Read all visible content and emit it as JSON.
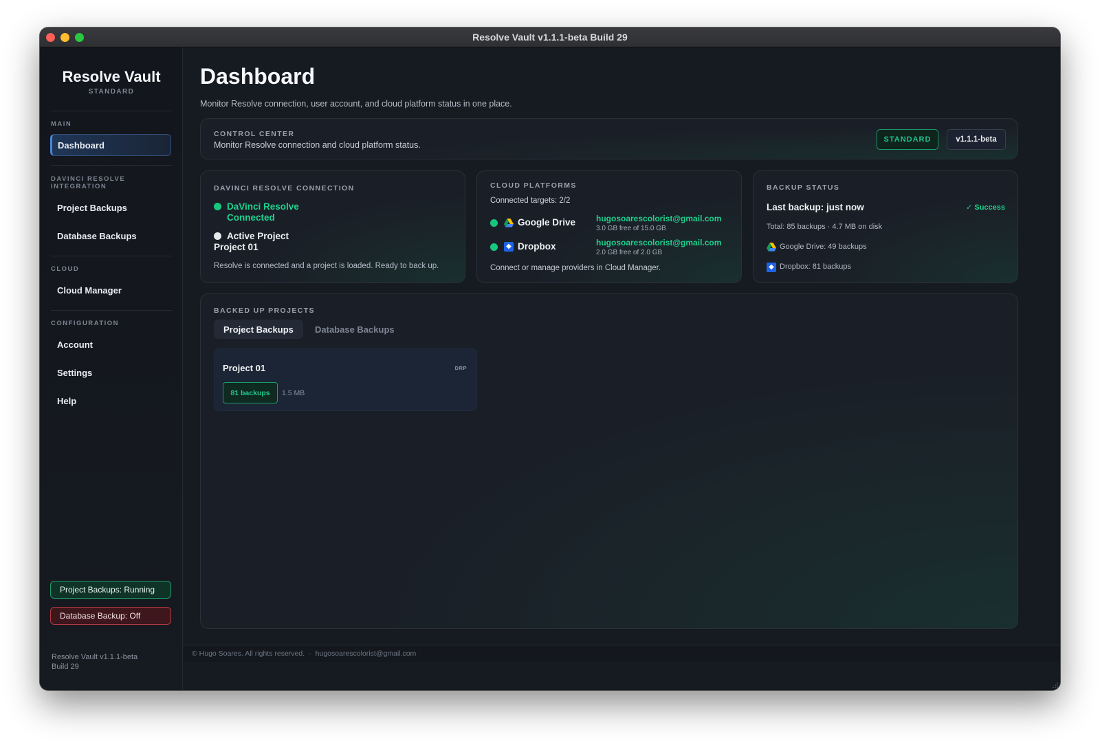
{
  "window": {
    "title": "Resolve Vault v1.1.1-beta Build 29"
  },
  "sidebar": {
    "app_name": "Resolve Vault",
    "tier": "STANDARD",
    "sections": {
      "main": "MAIN",
      "integration": "DAVINCI RESOLVE INTEGRATION",
      "cloud": "CLOUD",
      "configuration": "CONFIGURATION"
    },
    "items": {
      "dashboard": "Dashboard",
      "project_backups": "Project Backups",
      "database_backups": "Database Backups",
      "cloud_manager": "Cloud Manager",
      "account": "Account",
      "settings": "Settings",
      "help": "Help"
    },
    "status": {
      "project_backups": "Project Backups: Running",
      "database_backup": "Database Backup: Off"
    },
    "version_line1": "Resolve Vault v1.1.1-beta",
    "version_line2": "Build 29"
  },
  "header": {
    "title": "Dashboard",
    "subtitle": "Monitor Resolve connection, user account, and cloud platform status in one place."
  },
  "control_center": {
    "label": "CONTROL CENTER",
    "description": "Monitor Resolve connection and cloud platform status.",
    "tier_badge": "STANDARD",
    "version_badge": "v1.1.1-beta"
  },
  "resolve_connection": {
    "label": "DAVINCI RESOLVE CONNECTION",
    "status_line1": "DaVinci Resolve",
    "status_line2": "Connected",
    "project_label": "Active Project",
    "project_name": "Project 01",
    "message": "Resolve is connected and a project is loaded. Ready to back up."
  },
  "cloud_platforms": {
    "label": "CLOUD PLATFORMS",
    "connected_targets": "Connected targets: 2/2",
    "providers": [
      {
        "name": "Google Drive",
        "email": "hugosoarescolorist@gmail.com",
        "storage": "3.0 GB free of 15.0 GB",
        "icon": "google-drive-icon"
      },
      {
        "name": "Dropbox",
        "email": "hugosoarescolorist@gmail.com",
        "storage": "2.0 GB free of 2.0 GB",
        "icon": "dropbox-icon"
      }
    ],
    "footer": "Connect or manage providers in Cloud Manager."
  },
  "backup_status": {
    "label": "BACKUP STATUS",
    "last_backup": "Last backup: just now",
    "result": "✓ Success",
    "total": "Total: 85 backups · 4.7 MB on disk",
    "google_drive": "Google Drive: 49 backups",
    "dropbox": "Dropbox: 81 backups"
  },
  "backed_up_projects": {
    "label": "BACKED UP PROJECTS",
    "tabs": [
      "Project Backups",
      "Database Backups"
    ],
    "projects": [
      {
        "name": "Project 01",
        "type": "DRP",
        "backups": "81 backups",
        "size": "1.5 MB"
      }
    ]
  },
  "footer": {
    "copyright": "© Hugo Soares. All rights reserved.",
    "separator": "·",
    "email": "hugosoarescolorist@gmail.com"
  },
  "colors": {
    "accent_green": "#1fd08d",
    "accent_blue": "#4a86d8",
    "status_red": "#b43a44",
    "background": "#161a21"
  }
}
